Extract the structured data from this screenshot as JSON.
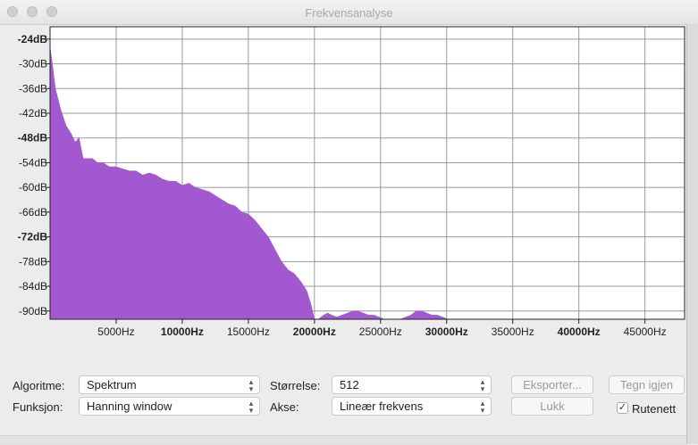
{
  "window": {
    "title": "Frekvensanalyse"
  },
  "chart_data": {
    "type": "area",
    "xlabel": "",
    "ylabel": "",
    "xlim": [
      0,
      48000
    ],
    "ylim": [
      -92,
      -21
    ],
    "grid": true,
    "fill_color": "#a259d0",
    "x_ticks": [
      {
        "value": 5000,
        "label": "5000Hz",
        "bold": false
      },
      {
        "value": 10000,
        "label": "10000Hz",
        "bold": true
      },
      {
        "value": 15000,
        "label": "15000Hz",
        "bold": false
      },
      {
        "value": 20000,
        "label": "20000Hz",
        "bold": true
      },
      {
        "value": 25000,
        "label": "25000Hz",
        "bold": false
      },
      {
        "value": 30000,
        "label": "30000Hz",
        "bold": true
      },
      {
        "value": 35000,
        "label": "35000Hz",
        "bold": false
      },
      {
        "value": 40000,
        "label": "40000Hz",
        "bold": true
      },
      {
        "value": 45000,
        "label": "45000Hz",
        "bold": false
      }
    ],
    "y_ticks": [
      {
        "value": -24,
        "label": "-24dB",
        "bold": true
      },
      {
        "value": -30,
        "label": "-30dB",
        "bold": false
      },
      {
        "value": -36,
        "label": "-36dB",
        "bold": false
      },
      {
        "value": -42,
        "label": "-42dB",
        "bold": false
      },
      {
        "value": -48,
        "label": "-48dB",
        "bold": true
      },
      {
        "value": -54,
        "label": "-54dB",
        "bold": false
      },
      {
        "value": -60,
        "label": "-60dB",
        "bold": false
      },
      {
        "value": -66,
        "label": "-66dB",
        "bold": false
      },
      {
        "value": -72,
        "label": "-72dB",
        "bold": true
      },
      {
        "value": -78,
        "label": "-78dB",
        "bold": false
      },
      {
        "value": -84,
        "label": "-84dB",
        "bold": false
      },
      {
        "value": -90,
        "label": "-90dB",
        "bold": false
      }
    ],
    "series": [
      {
        "x": [
          0,
          170,
          400,
          800,
          1200,
          1600,
          1900,
          2200,
          2500,
          2800,
          3200,
          3600,
          4000,
          4500,
          5000,
          5500,
          6000,
          6500,
          7000,
          7500,
          8000,
          8500,
          9000,
          9500,
          10000,
          10500,
          11000,
          11500,
          12000,
          12500,
          13000,
          13500,
          14000,
          14500,
          15000,
          15500,
          16000,
          16500,
          17000,
          17500,
          18000,
          18500,
          19000,
          19400,
          19700,
          20000,
          20300,
          20700,
          21000,
          21300,
          21700,
          22100,
          22500,
          22900,
          23300,
          23700,
          24100,
          24500,
          24900,
          25300,
          25700,
          26100,
          26500,
          26900,
          27300,
          27700,
          28100,
          28500,
          28900,
          29300,
          29700,
          30100,
          30500
        ],
        "y": [
          -26,
          -30,
          -36,
          -41,
          -45,
          -47,
          -49,
          -48,
          -53,
          -53,
          -53,
          -54,
          -54,
          -55,
          -55,
          -55.5,
          -56,
          -56,
          -57,
          -56.5,
          -57,
          -58,
          -58.5,
          -58.5,
          -59.5,
          -59,
          -60,
          -60.5,
          -61,
          -62,
          -63,
          -64,
          -64.5,
          -66,
          -66.5,
          -68,
          -70,
          -72,
          -75,
          -78,
          -80,
          -81,
          -83,
          -85,
          -88,
          -92,
          -92,
          -91,
          -90.5,
          -91,
          -91.5,
          -91,
          -90.5,
          -90,
          -90,
          -90.5,
          -91,
          -91,
          -91.5,
          -92,
          -92,
          -92,
          -92,
          -91.5,
          -91,
          -90,
          -90,
          -90.5,
          -91,
          -91,
          -91.5,
          -92,
          -92
        ]
      }
    ]
  },
  "controls": {
    "algorithm": {
      "label": "Algoritme:",
      "value": "Spektrum"
    },
    "function": {
      "label": "Funksjon:",
      "value": "Hanning window"
    },
    "size": {
      "label": "Størrelse:",
      "value": "512"
    },
    "axis": {
      "label": "Akse:",
      "value": "Lineær frekvens"
    },
    "export_label": "Eksporter...",
    "replot_label": "Tegn igjen",
    "close_label": "Lukk",
    "grid_checkbox": {
      "label": "Rutenett",
      "checked": true
    }
  }
}
